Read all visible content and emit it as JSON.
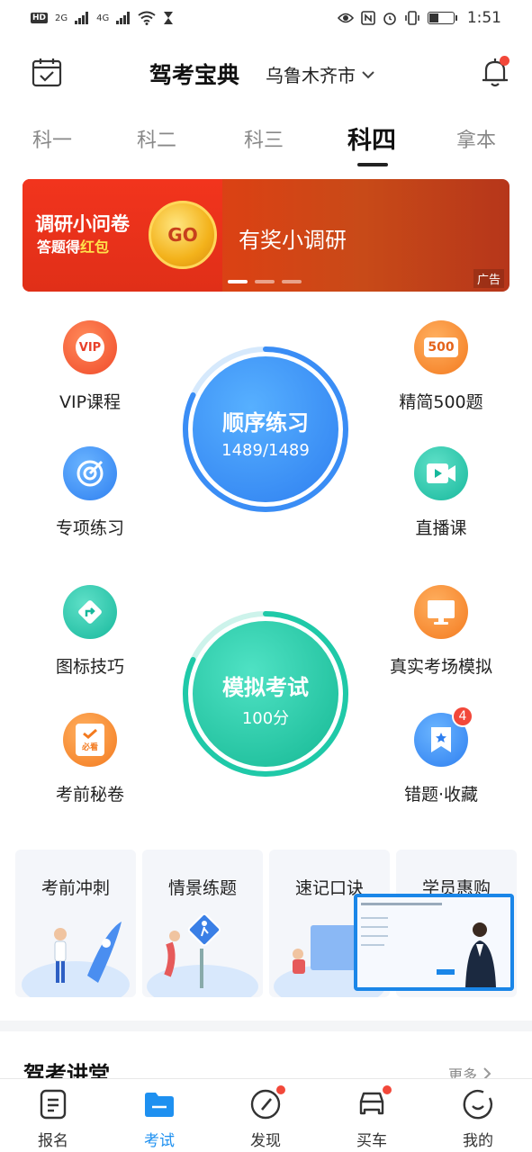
{
  "status_bar": {
    "left_badges": [
      "HD",
      "2G",
      "4G"
    ],
    "time": "1:51",
    "battery_level": 0.4
  },
  "header": {
    "title": "驾考宝典",
    "city": "乌鲁木齐市"
  },
  "tabs": [
    {
      "label": "科一",
      "active": false
    },
    {
      "label": "科二",
      "active": false
    },
    {
      "label": "科三",
      "active": false
    },
    {
      "label": "科四",
      "active": true
    },
    {
      "label": "拿本",
      "active": false
    }
  ],
  "banner": {
    "title": "调研小问卷",
    "subtitle_prefix": "答题得",
    "subtitle_highlight": "红包",
    "go": "GO",
    "main_text": "有奖小调研",
    "ad_label": "广告",
    "page_count": 3,
    "active_page": 0
  },
  "grid": {
    "vip": "VIP课程",
    "jingjian": "精简500题",
    "zhuanxiang": "专项练习",
    "zhibo": "直播课",
    "tubiao": "图标技巧",
    "zhenshi": "真实考场模拟",
    "kaoqian": "考前秘卷",
    "cuoti": "错题·收藏",
    "cuoti_badge": "4",
    "vip_icon_text": "VIP",
    "jingjian_icon_text": "500",
    "kaoqian_icon_text": "必看"
  },
  "practice": {
    "title": "顺序练习",
    "value": "1489/1489",
    "progress": 1.0
  },
  "exam": {
    "title": "模拟考试",
    "value": "100分",
    "progress": 1.0
  },
  "cards": [
    "考前冲刺",
    "情景练题",
    "速记口诀",
    "学员惠购"
  ],
  "section": {
    "title": "驾考讲堂",
    "more": "更多"
  },
  "tabbar": [
    {
      "label": "报名",
      "active": false,
      "dot": false
    },
    {
      "label": "考试",
      "active": true,
      "dot": false
    },
    {
      "label": "发现",
      "active": false,
      "dot": true
    },
    {
      "label": "买车",
      "active": false,
      "dot": true
    },
    {
      "label": "我的",
      "active": false,
      "dot": false
    }
  ],
  "colors": {
    "accent_blue": "#1e90f0",
    "practice_blue": "#3a8df5",
    "exam_green": "#1fc9a8",
    "notify_red": "#f2483a",
    "banner_red": "#e83a1e"
  }
}
